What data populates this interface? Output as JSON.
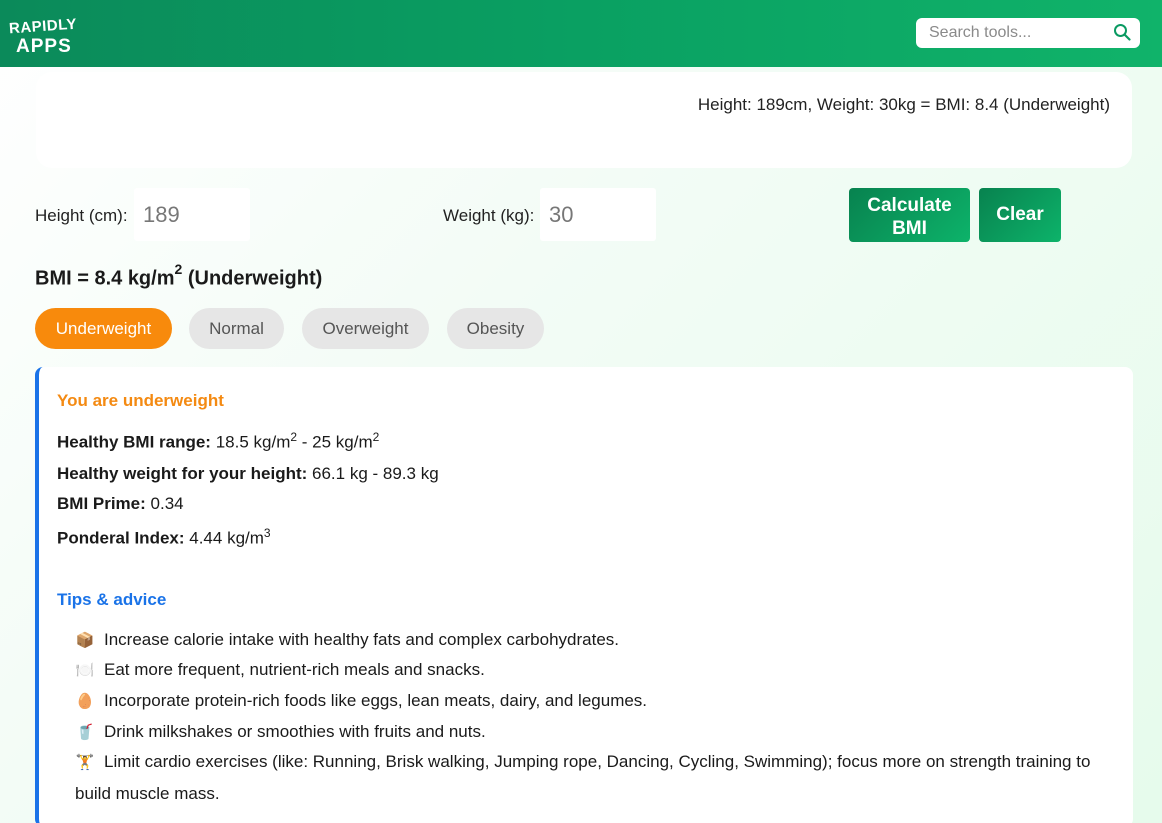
{
  "header": {
    "logo_line1": "RAPIDLY",
    "logo_line2": "APPS",
    "search_placeholder": "Search tools...",
    "search_icon": "search-icon"
  },
  "summary": {
    "text": "Height: 189cm, Weight: 30kg = BMI: 8.4 (Underweight)"
  },
  "form": {
    "height_label": "Height (cm):",
    "height_value": "189",
    "weight_label": "Weight (kg):",
    "weight_value": "30",
    "calculate_line1": "Calculate",
    "calculate_line2": "BMI",
    "clear_label": "Clear"
  },
  "result": {
    "bmi_prefix": "BMI = 8.4 kg/m",
    "bmi_sup": "2",
    "bmi_suffix": " (Underweight)"
  },
  "categories": [
    {
      "label": "Underweight",
      "active": true
    },
    {
      "label": "Normal",
      "active": false
    },
    {
      "label": "Overweight",
      "active": false
    },
    {
      "label": "Obesity",
      "active": false
    }
  ],
  "details": {
    "title": "You are underweight",
    "healthy_range_label": "Healthy BMI range:",
    "healthy_range_value_a": " 18.5 kg/m",
    "healthy_range_value_b": " - 25 kg/m",
    "sup2": "2",
    "healthy_weight_label": "Healthy weight for your height:",
    "healthy_weight_value": " 66.1 kg - 89.3 kg",
    "bmi_prime_label": "BMI Prime:",
    "bmi_prime_value": " 0.34",
    "ponderal_label": "Ponderal Index:",
    "ponderal_value": " 4.44 kg/m",
    "sup3": "3"
  },
  "tips": {
    "title": "Tips & advice",
    "items": [
      {
        "emoji": "📦",
        "text": "Increase calorie intake with healthy fats and complex carbohydrates."
      },
      {
        "emoji": "🍽️",
        "text": "Eat more frequent, nutrient-rich meals and snacks."
      },
      {
        "emoji": "🥚",
        "text": "Incorporate protein-rich foods like eggs, lean meats, dairy, and legumes."
      },
      {
        "emoji": "🥤",
        "text": "Drink milkshakes or smoothies with fruits and nuts."
      },
      {
        "emoji": "🏋️",
        "text": "Limit cardio exercises (like: Running, Brisk walking, Jumping rope, Dancing, Cycling, Swimming); focus more on strength training to build muscle mass."
      }
    ]
  },
  "colors": {
    "brand_green": "#0aa062",
    "accent_orange": "#f88a0c",
    "link_blue": "#1a73e8"
  }
}
